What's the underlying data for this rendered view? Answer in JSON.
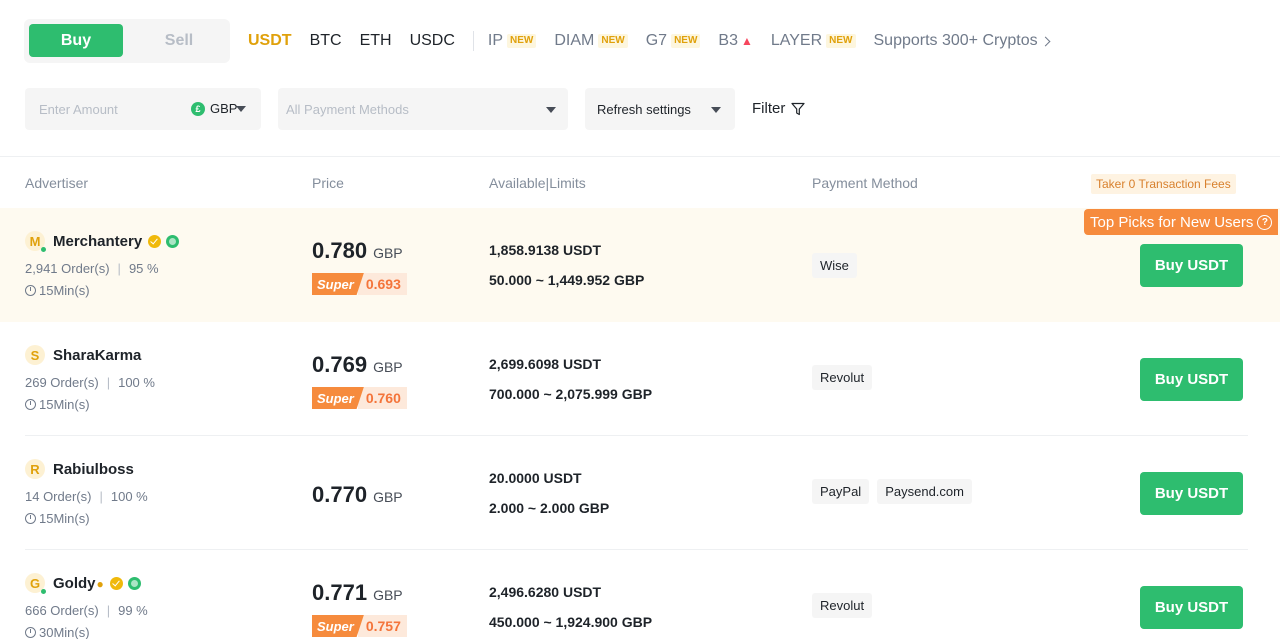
{
  "trade_side": {
    "buy": "Buy",
    "sell": "Sell"
  },
  "crypto_tabs": {
    "usdt": "USDT",
    "btc": "BTC",
    "eth": "ETH",
    "usdc": "USDC",
    "ip": "IP",
    "diam": "DIAM",
    "g7": "G7",
    "b3": "B3",
    "layer": "LAYER",
    "new_badge": "NEW",
    "supports": "Supports 300+ Cryptos"
  },
  "filters": {
    "amount_placeholder": "Enter Amount",
    "currency": "GBP",
    "currency_icon": "£",
    "payment_placeholder": "All Payment Methods",
    "refresh": "Refresh settings",
    "filter": "Filter"
  },
  "table_header": {
    "advertiser": "Advertiser",
    "price": "Price",
    "available": "Available|Limits",
    "payment": "Payment Method",
    "fees": "Taker 0 Transaction Fees"
  },
  "top_picks": "Top Picks for New Users",
  "rows": [
    {
      "initial": "M",
      "name": "Merchantery",
      "orders": "2,941 Order(s)",
      "completion": "95 %",
      "time": "15Min(s)",
      "price": "0.780",
      "currency": "GBP",
      "super_label": "Super",
      "super_price": "0.693",
      "available": "1,858.9138 USDT",
      "limits": "50.000 ~ 1,449.952 GBP",
      "payments": [
        "Wise"
      ],
      "action": "Buy USDT"
    },
    {
      "initial": "S",
      "name": "SharaKarma",
      "orders": "269 Order(s)",
      "completion": "100 %",
      "time": "15Min(s)",
      "price": "0.769",
      "currency": "GBP",
      "super_label": "Super",
      "super_price": "0.760",
      "available": "2,699.6098 USDT",
      "limits": "700.000 ~ 2,075.999 GBP",
      "payments": [
        "Revolut"
      ],
      "action": "Buy USDT"
    },
    {
      "initial": "R",
      "name": "Rabiulboss",
      "orders": "14 Order(s)",
      "completion": "100 %",
      "time": "15Min(s)",
      "price": "0.770",
      "currency": "GBP",
      "available": "20.0000 USDT",
      "limits": "2.000 ~ 2.000 GBP",
      "payments": [
        "PayPal",
        "Paysend.com"
      ],
      "action": "Buy USDT"
    },
    {
      "initial": "G",
      "name": "Goldy",
      "orders": "666 Order(s)",
      "completion": "99 %",
      "time": "30Min(s)",
      "price": "0.771",
      "currency": "GBP",
      "super_label": "Super",
      "super_price": "0.757",
      "available": "2,496.6280 USDT",
      "limits": "450.000 ~ 1,924.900 GBP",
      "payments": [
        "Revolut"
      ],
      "action": "Buy USDT"
    }
  ],
  "colors": {
    "buy_green": "#2ebd6f",
    "accent_yellow": "#e0a10b",
    "super_orange": "#f68b3d"
  }
}
